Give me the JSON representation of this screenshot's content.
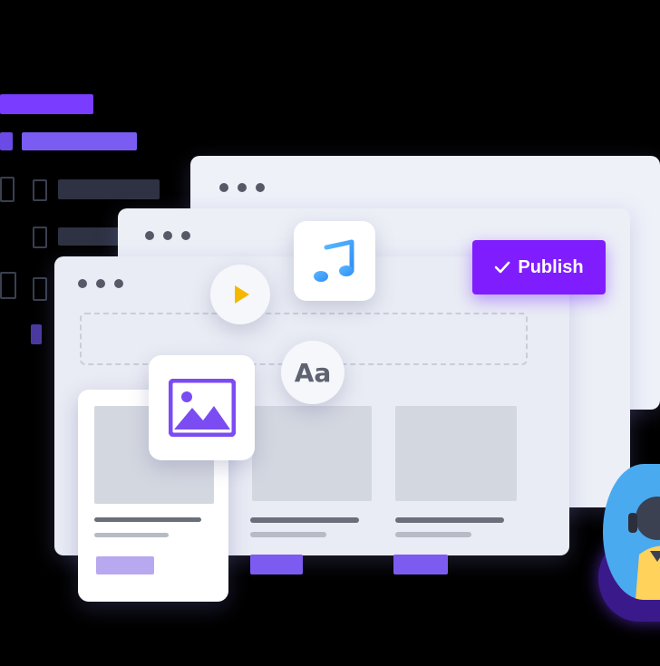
{
  "publish_button": {
    "label": "Publish"
  },
  "text_style_icon": {
    "label": "Aa"
  },
  "colors": {
    "accent": "#7f1dff",
    "accent_light": "#7c5cf0",
    "window_bg": "#eef1f8",
    "background": "#000000"
  },
  "icons": [
    "music-note-icon",
    "play-icon",
    "image-icon",
    "text-icon",
    "checkmark-icon",
    "avatar-icon"
  ]
}
